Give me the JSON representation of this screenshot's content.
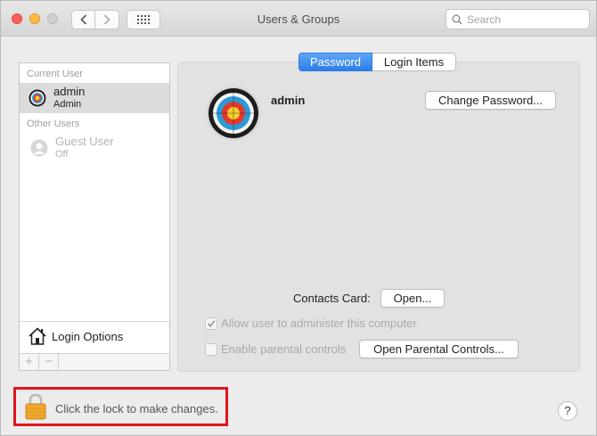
{
  "window": {
    "title": "Users & Groups"
  },
  "search": {
    "placeholder": "Search"
  },
  "sidebar": {
    "current_user_header": "Current User",
    "current_user": {
      "name": "admin",
      "role": "Admin"
    },
    "other_users_header": "Other Users",
    "guest_user": {
      "name": "Guest User",
      "status": "Off"
    },
    "login_options_label": "Login Options",
    "add_label": "+",
    "remove_label": "−"
  },
  "tabs": {
    "password": "Password",
    "login_items": "Login Items"
  },
  "main": {
    "user_name": "admin",
    "change_password_label": "Change Password...",
    "contacts_card_label": "Contacts Card:",
    "open_label": "Open...",
    "allow_admin_label": "Allow user to administer this computer",
    "allow_admin_checked": true,
    "parental_controls_label": "Enable parental controls",
    "parental_controls_checked": false,
    "open_parental_controls_label": "Open Parental Controls..."
  },
  "lock": {
    "text": "Click the lock to make changes."
  },
  "help": {
    "label": "?"
  },
  "colors": {
    "accent": "#2d7de7",
    "highlight_box": "#e2141c",
    "lock": "#f0a830"
  }
}
